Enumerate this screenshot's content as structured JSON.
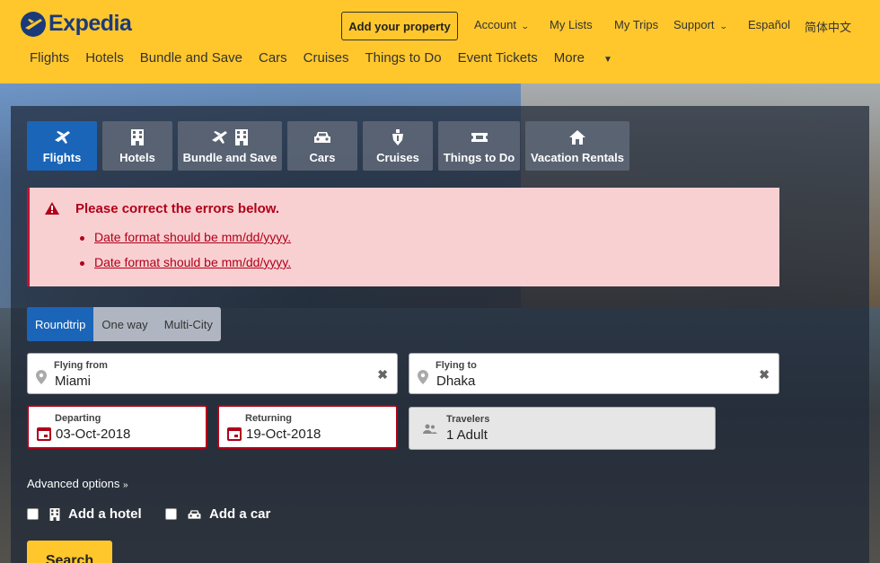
{
  "header": {
    "brand": "Expedia",
    "add_property": "Add your property",
    "account": "Account",
    "my_lists": "My Lists",
    "my_trips": "My Trips",
    "support": "Support",
    "espanol": "Español",
    "chinese": "简体中文",
    "nav": [
      "Flights",
      "Hotels",
      "Bundle and Save",
      "Cars",
      "Cruises",
      "Things to Do",
      "Event Tickets",
      "More"
    ]
  },
  "tabs": [
    {
      "label": "Flights",
      "icon": "plane-icon",
      "active": true
    },
    {
      "label": "Hotels",
      "icon": "building-icon"
    },
    {
      "label": "Bundle and Save",
      "icon": "plane-building-icon"
    },
    {
      "label": "Cars",
      "icon": "car-icon"
    },
    {
      "label": "Cruises",
      "icon": "ship-icon"
    },
    {
      "label": "Things to Do",
      "icon": "ticket-icon"
    },
    {
      "label": "Vacation Rentals",
      "icon": "house-icon"
    }
  ],
  "error": {
    "title": "Please correct the errors below.",
    "items": [
      "Date format should be mm/dd/yyyy.",
      "Date format should be mm/dd/yyyy."
    ]
  },
  "trip_type": {
    "options": [
      "Roundtrip",
      "One way",
      "Multi-City"
    ],
    "selected": "Roundtrip"
  },
  "form": {
    "from": {
      "label": "Flying from",
      "value": "Miami"
    },
    "to": {
      "label": "Flying to",
      "value": "Dhaka"
    },
    "departing": {
      "label": "Departing",
      "value": "03-Oct-2018"
    },
    "returning": {
      "label": "Returning",
      "value": "19-Oct-2018"
    },
    "travelers": {
      "label": "Travelers",
      "value": "1 Adult"
    }
  },
  "advanced_options": "Advanced options",
  "addons": {
    "hotel": "Add a hotel",
    "car": "Add a car"
  },
  "search": "Search",
  "colors": {
    "header": "#ffc72c",
    "brand": "#1b3a7a",
    "active_tab": "#1a65b8",
    "error": "#b00018",
    "error_bg": "#f8d0d2"
  }
}
